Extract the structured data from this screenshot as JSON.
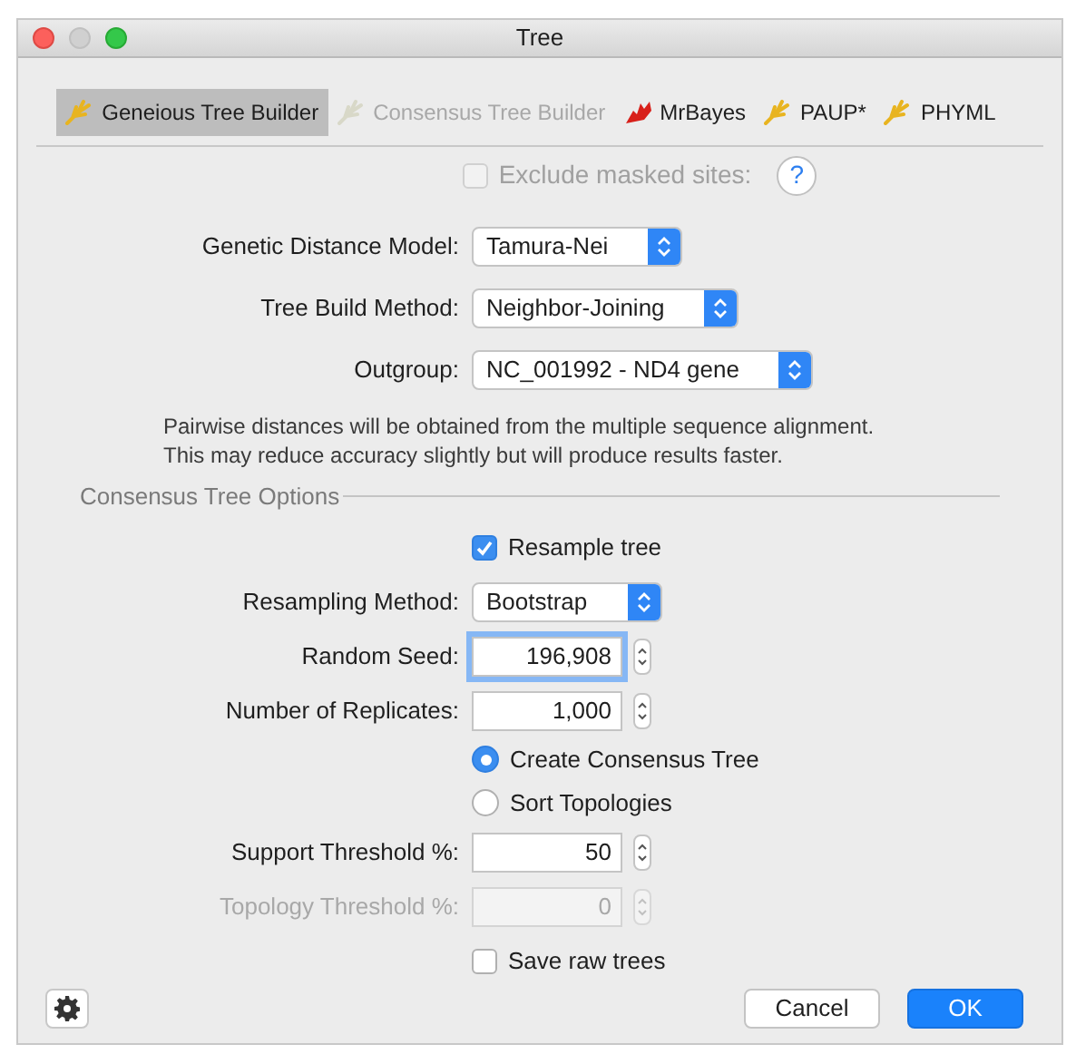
{
  "window": {
    "title": "Tree"
  },
  "tabs": [
    {
      "label": "Geneious Tree Builder",
      "selected": true,
      "disabled": false,
      "kind": "branch"
    },
    {
      "label": "Consensus Tree Builder",
      "selected": false,
      "disabled": true,
      "kind": "branch"
    },
    {
      "label": "MrBayes",
      "selected": false,
      "disabled": false,
      "kind": "flame"
    },
    {
      "label": "PAUP*",
      "selected": false,
      "disabled": false,
      "kind": "branch"
    },
    {
      "label": "PHYML",
      "selected": false,
      "disabled": false,
      "kind": "branch"
    }
  ],
  "exclude_masked_sites": {
    "label": "Exclude masked sites:",
    "checked": false,
    "disabled": true,
    "help": "?"
  },
  "fields": [
    {
      "kind": "select",
      "label": "Genetic Distance Model:",
      "value": "Tamura-Nei"
    },
    {
      "kind": "select",
      "label": "Tree Build Method:",
      "value": "Neighbor-Joining"
    },
    {
      "kind": "select",
      "label": "Outgroup:",
      "value": "NC_001992 - ND4 gene"
    }
  ],
  "note_lines": [
    "Pairwise distances will be obtained from the multiple sequence alignment.",
    "This may reduce accuracy slightly but will produce results faster."
  ],
  "consensus_options": {
    "title": "Consensus Tree Options",
    "rows": [
      {
        "kind": "checkbox",
        "label": "Resample tree",
        "checked": true
      },
      {
        "kind": "select",
        "label": "Resampling Method:",
        "value": "Bootstrap"
      },
      {
        "kind": "spinner",
        "label": "Random Seed:",
        "value": "196,908",
        "focused": true,
        "disabled": false
      },
      {
        "kind": "spinner",
        "label": "Number of Replicates:",
        "value": "1,000",
        "focused": false,
        "disabled": false
      },
      {
        "kind": "radio",
        "label": "Create Consensus Tree",
        "selected": true
      },
      {
        "kind": "radio",
        "label": "Sort Topologies",
        "selected": false
      },
      {
        "kind": "spinner",
        "label": "Support Threshold %:",
        "value": "50",
        "focused": false,
        "disabled": false
      },
      {
        "kind": "spinner",
        "label": "Topology Threshold %:",
        "value": "0",
        "focused": false,
        "disabled": true
      },
      {
        "kind": "checkbox",
        "label": "Save raw trees",
        "checked": false
      }
    ]
  },
  "buttons": [
    {
      "label": "Cancel",
      "default": false
    },
    {
      "label": "OK",
      "default": true
    }
  ]
}
